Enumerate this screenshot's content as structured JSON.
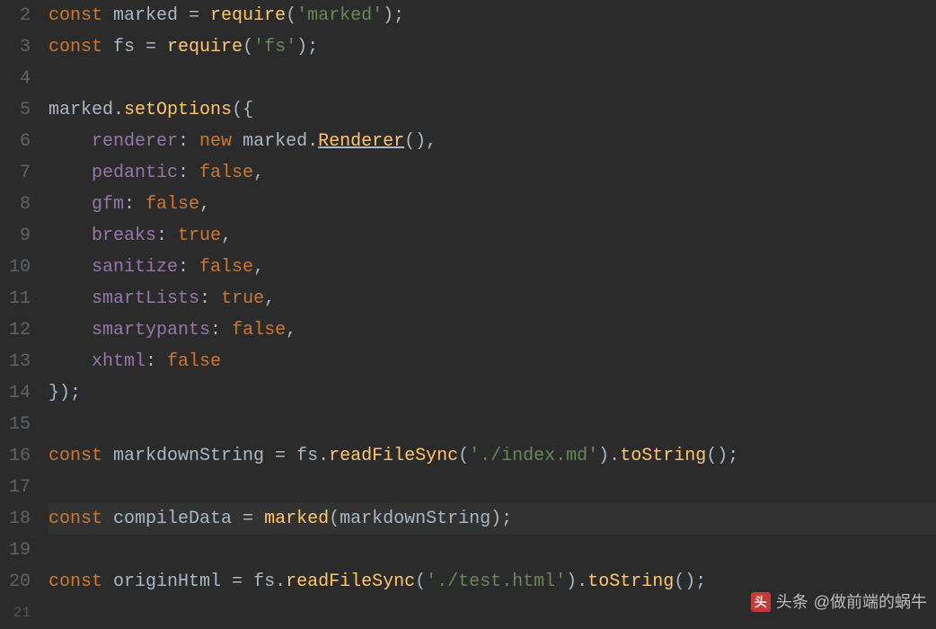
{
  "gutter": {
    "start": 2,
    "end": 21
  },
  "code": {
    "lines": [
      {
        "n": 2,
        "tokens": [
          {
            "t": "const ",
            "c": "tok-keyword"
          },
          {
            "t": "marked",
            "c": "tok-var"
          },
          {
            "t": " = ",
            "c": "tok-operator"
          },
          {
            "t": "require",
            "c": "tok-method"
          },
          {
            "t": "(",
            "c": "tok-punct"
          },
          {
            "t": "'marked'",
            "c": "tok-string"
          },
          {
            "t": ");",
            "c": "tok-punct"
          }
        ]
      },
      {
        "n": 3,
        "tokens": [
          {
            "t": "const ",
            "c": "tok-keyword"
          },
          {
            "t": "fs",
            "c": "tok-var"
          },
          {
            "t": " = ",
            "c": "tok-operator"
          },
          {
            "t": "require",
            "c": "tok-method"
          },
          {
            "t": "(",
            "c": "tok-punct"
          },
          {
            "t": "'fs'",
            "c": "tok-string"
          },
          {
            "t": ");",
            "c": "tok-punct"
          }
        ]
      },
      {
        "n": 4,
        "tokens": []
      },
      {
        "n": 5,
        "tokens": [
          {
            "t": "marked",
            "c": "tok-var"
          },
          {
            "t": ".",
            "c": "tok-punct"
          },
          {
            "t": "setOptions",
            "c": "tok-method"
          },
          {
            "t": "({",
            "c": "tok-punct"
          }
        ]
      },
      {
        "n": 6,
        "indent": true,
        "tokens": [
          {
            "t": "    ",
            "c": ""
          },
          {
            "t": "renderer",
            "c": "tok-prop"
          },
          {
            "t": ": ",
            "c": "tok-punct"
          },
          {
            "t": "new ",
            "c": "tok-new"
          },
          {
            "t": "marked",
            "c": "tok-var"
          },
          {
            "t": ".",
            "c": "tok-punct"
          },
          {
            "t": "Renderer",
            "c": "tok-method tok-underline"
          },
          {
            "t": "(),",
            "c": "tok-punct"
          }
        ]
      },
      {
        "n": 7,
        "indent": true,
        "tokens": [
          {
            "t": "    ",
            "c": ""
          },
          {
            "t": "pedantic",
            "c": "tok-prop"
          },
          {
            "t": ": ",
            "c": "tok-punct"
          },
          {
            "t": "false",
            "c": "tok-bool"
          },
          {
            "t": ",",
            "c": "tok-punct"
          }
        ]
      },
      {
        "n": 8,
        "indent": true,
        "tokens": [
          {
            "t": "    ",
            "c": ""
          },
          {
            "t": "gfm",
            "c": "tok-prop"
          },
          {
            "t": ": ",
            "c": "tok-punct"
          },
          {
            "t": "false",
            "c": "tok-bool"
          },
          {
            "t": ",",
            "c": "tok-punct"
          }
        ]
      },
      {
        "n": 9,
        "indent": true,
        "tokens": [
          {
            "t": "    ",
            "c": ""
          },
          {
            "t": "breaks",
            "c": "tok-prop"
          },
          {
            "t": ": ",
            "c": "tok-punct"
          },
          {
            "t": "true",
            "c": "tok-bool"
          },
          {
            "t": ",",
            "c": "tok-punct"
          }
        ]
      },
      {
        "n": 10,
        "indent": true,
        "tokens": [
          {
            "t": "    ",
            "c": ""
          },
          {
            "t": "sanitize",
            "c": "tok-prop"
          },
          {
            "t": ": ",
            "c": "tok-punct"
          },
          {
            "t": "false",
            "c": "tok-bool"
          },
          {
            "t": ",",
            "c": "tok-punct"
          }
        ]
      },
      {
        "n": 11,
        "indent": true,
        "tokens": [
          {
            "t": "    ",
            "c": ""
          },
          {
            "t": "smartLists",
            "c": "tok-prop"
          },
          {
            "t": ": ",
            "c": "tok-punct"
          },
          {
            "t": "true",
            "c": "tok-bool"
          },
          {
            "t": ",",
            "c": "tok-punct"
          }
        ]
      },
      {
        "n": 12,
        "indent": true,
        "tokens": [
          {
            "t": "    ",
            "c": ""
          },
          {
            "t": "smartypants",
            "c": "tok-prop"
          },
          {
            "t": ": ",
            "c": "tok-punct"
          },
          {
            "t": "false",
            "c": "tok-bool"
          },
          {
            "t": ",",
            "c": "tok-punct"
          }
        ]
      },
      {
        "n": 13,
        "indent": true,
        "tokens": [
          {
            "t": "    ",
            "c": ""
          },
          {
            "t": "xhtml",
            "c": "tok-prop"
          },
          {
            "t": ": ",
            "c": "tok-punct"
          },
          {
            "t": "false",
            "c": "tok-bool"
          }
        ]
      },
      {
        "n": 14,
        "tokens": [
          {
            "t": "});",
            "c": "tok-punct"
          }
        ]
      },
      {
        "n": 15,
        "tokens": []
      },
      {
        "n": 16,
        "tokens": [
          {
            "t": "const ",
            "c": "tok-keyword"
          },
          {
            "t": "markdownString",
            "c": "tok-var"
          },
          {
            "t": " = ",
            "c": "tok-operator"
          },
          {
            "t": "fs",
            "c": "tok-var"
          },
          {
            "t": ".",
            "c": "tok-punct"
          },
          {
            "t": "readFileSync",
            "c": "tok-method"
          },
          {
            "t": "(",
            "c": "tok-punct"
          },
          {
            "t": "'./index.md'",
            "c": "tok-string"
          },
          {
            "t": ").",
            "c": "tok-punct"
          },
          {
            "t": "toString",
            "c": "tok-method"
          },
          {
            "t": "();",
            "c": "tok-punct"
          }
        ]
      },
      {
        "n": 17,
        "tokens": []
      },
      {
        "n": 18,
        "highlighted": true,
        "tokens": [
          {
            "t": "const ",
            "c": "tok-keyword"
          },
          {
            "t": "compileData",
            "c": "tok-var"
          },
          {
            "t": " = ",
            "c": "tok-operator"
          },
          {
            "t": "marked",
            "c": "tok-method"
          },
          {
            "t": "(",
            "c": "tok-punct"
          },
          {
            "t": "markdownString",
            "c": "tok-var"
          },
          {
            "t": ");",
            "c": "tok-punct"
          }
        ]
      },
      {
        "n": 19,
        "tokens": []
      },
      {
        "n": 20,
        "tokens": [
          {
            "t": "const ",
            "c": "tok-keyword"
          },
          {
            "t": "originHtml",
            "c": "tok-var"
          },
          {
            "t": " = ",
            "c": "tok-operator"
          },
          {
            "t": "fs",
            "c": "tok-var"
          },
          {
            "t": ".",
            "c": "tok-punct"
          },
          {
            "t": "readFileSync",
            "c": "tok-method"
          },
          {
            "t": "(",
            "c": "tok-punct"
          },
          {
            "t": "'./test.html'",
            "c": "tok-string"
          },
          {
            "t": ").",
            "c": "tok-punct"
          },
          {
            "t": "toString",
            "c": "tok-method"
          },
          {
            "t": "();",
            "c": "tok-punct"
          }
        ]
      }
    ]
  },
  "watermark": {
    "prefix": "头条",
    "handle": "@做前端的蜗牛"
  }
}
